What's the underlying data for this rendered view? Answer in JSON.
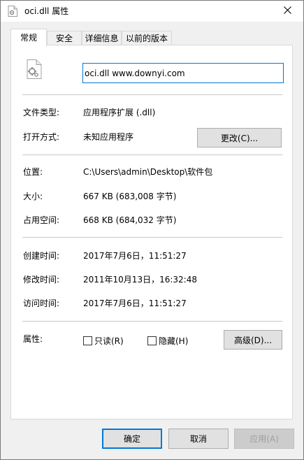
{
  "window": {
    "title": "oci.dll 属性",
    "close_icon": "close-icon",
    "title_icon": "dll-file-icon"
  },
  "tabs": [
    {
      "label": "常规",
      "active": true
    },
    {
      "label": "安全",
      "active": false
    },
    {
      "label": "详细信息",
      "active": false
    },
    {
      "label": "以前的版本",
      "active": false
    }
  ],
  "general": {
    "file_icon": "dll-file-icon",
    "file_name": "oci.dll www.downyi.com",
    "type_label": "文件类型:",
    "type_value": "应用程序扩展 (.dll)",
    "opens_with_label": "打开方式:",
    "opens_with_value": "未知应用程序",
    "change_button": "更改(C)...",
    "location_label": "位置:",
    "location_value": "C:\\Users\\admin\\Desktop\\软件包",
    "size_label": "大小:",
    "size_value": "667 KB (683,008 字节)",
    "size_on_disk_label": "占用空间:",
    "size_on_disk_value": "668 KB (684,032 字节)",
    "created_label": "创建时间:",
    "created_value": "2017年7月6日，11:51:27",
    "modified_label": "修改时间:",
    "modified_value": "2011年10月13日，16:32:48",
    "accessed_label": "访问时间:",
    "accessed_value": "2017年7月6日，11:51:27",
    "attributes_label": "属性:",
    "readonly_label": "只读(R)",
    "readonly_checked": false,
    "hidden_label": "隐藏(H)",
    "hidden_checked": false,
    "advanced_button": "高级(D)..."
  },
  "footer": {
    "ok_button": "确定",
    "cancel_button": "取消",
    "apply_button": "应用(A)"
  },
  "colors": {
    "accent": "#0078d7",
    "window_bg": "#f0f0f0",
    "panel_bg": "#ffffff",
    "button_bg": "#e1e1e1"
  }
}
